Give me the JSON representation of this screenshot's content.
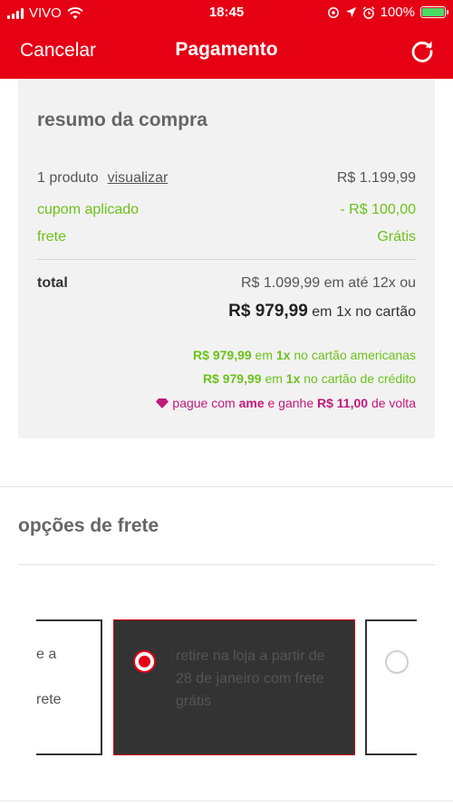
{
  "status_bar": {
    "carrier": "VIVO",
    "time": "18:45",
    "battery": "100%",
    "battery_level": 1.0,
    "icons": [
      "signal-icon",
      "wifi-icon",
      "location-icon",
      "alarm-icon",
      "battery-icon"
    ]
  },
  "header": {
    "cancel_label": "Cancelar",
    "title": "Pagamento",
    "refresh_icon": "refresh-icon",
    "background_color": "#e60014"
  },
  "summary": {
    "title": "resumo da compra",
    "product_count": "1 produto",
    "view_link": "visualizar",
    "product_price": "R$ 1.199,99",
    "coupon_label": "cupom aplicado",
    "coupon_value": "- R$ 100,00",
    "shipping_label": "frete",
    "shipping_value": "Grátis",
    "total_label": "total",
    "installments_price": "R$ 1.099,99",
    "installments_text": "em até 12x ou",
    "cash_price": "R$ 979,99",
    "cash_text": "em 1x no cartão",
    "promo_americanas_price": "R$ 979,99",
    "promo_americanas_mid": "em",
    "promo_americanas_times": "1x",
    "promo_americanas_tail": "no cartão americanas",
    "promo_credit_price": "R$ 979,99",
    "promo_credit_mid": "em",
    "promo_credit_times": "1x",
    "promo_credit_tail": "no cartão de crédito",
    "ame_prefix": "pague com",
    "ame_brand": "ame",
    "ame_mid": "e ganhe",
    "ame_amount": "R$ 11,00",
    "ame_tail": "de volta",
    "accent_green": "#6cc21a",
    "accent_pink": "#c2187c"
  },
  "shipping": {
    "title": "opções de frete",
    "left_option_line1": "e a",
    "left_option_line2": "rete",
    "selected_option_text": "retire na loja a partir de 28 de janeiro com frete grátis",
    "selected_color": "#e60014"
  }
}
